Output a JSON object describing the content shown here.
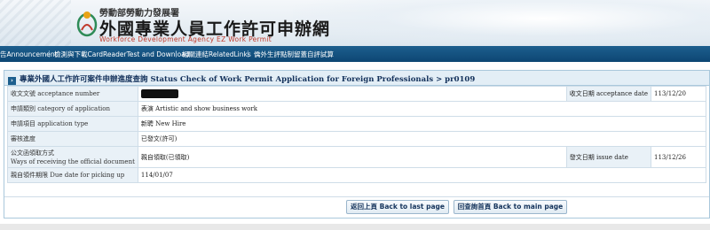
{
  "header": {
    "org_name": "勞動部勞動力發展署",
    "site_title": "外國專業人員工作許可申辦網",
    "site_subtitle": "Workforce Development Agency EZ Work Permit"
  },
  "nav": {
    "items": [
      {
        "label": "告Announcement"
      },
      {
        "label": "檢測與下載CardReaderTest and Download"
      },
      {
        "label": "相關連結RelatedLinks"
      },
      {
        "label": "僑外生評點制留蓋自評試算"
      }
    ]
  },
  "panel": {
    "title": "專業外國人工作許可案件申辦進度查詢 Status Check of Work Permit Application for Foreign Professionals > pr0109",
    "rows": {
      "receipt_label": "收文文號 acceptance number",
      "receipt_date_label": "收文日期 acceptance date",
      "receipt_date_value": "113/12/20",
      "category_label": "申請類別 category of application",
      "category_value": "表演 Artistic and show business work",
      "type_label": "申請項目 application type",
      "type_value": "新聘 New Hire",
      "progress_label": "審核進度",
      "progress_value": "已發文(許可)",
      "receive_method_label_1": "公文函領取方式",
      "receive_method_label_2": "Ways of receiving the official document",
      "receive_method_value": "親自領取(已領取)",
      "issue_date_label": "發文日期 issue date",
      "issue_date_value": "113/12/26",
      "due_label": "親自領件期限 Due date for picking up",
      "due_value": "114/01/07"
    },
    "buttons": {
      "back": "返回上頁 Back to last page",
      "main": "回查詢首頁 Back to main page"
    }
  }
}
